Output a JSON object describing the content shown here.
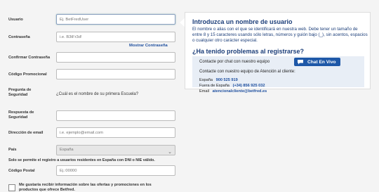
{
  "form": {
    "usuario": {
      "label": "Usuario",
      "placeholder": "Ej. BetFredUser"
    },
    "contrasena": {
      "label": "Contraseña",
      "placeholder": "i.e. B3tFr3d!"
    },
    "mostrar": "Mostrar Contraseña",
    "confirmar": {
      "label": "Confirmar Contraseña"
    },
    "promo": {
      "label": "Código Promocional"
    },
    "pregunta": {
      "label_line1": "Pregunta de",
      "label_line2": "Seguridad",
      "value": "¿Cuál es el nombre de su primera Escuela?"
    },
    "respuesta": {
      "label_line1": "Respuesta de",
      "label_line2": "Seguridad"
    },
    "email": {
      "label": "Dirección de email",
      "placeholder": "i.e. ejemplo@email.com"
    },
    "pais": {
      "label": "País",
      "value": "España"
    },
    "residentes_note": "Solo se permite el registro a usuarios residentes en España con DNI o NIE válido.",
    "postal": {
      "label": "Código Postal",
      "placeholder": "Ej.:00000"
    },
    "ofertas": "Me gustaría recibir información sobre las ofertas y promociones en los productos que ofrece Betfred."
  },
  "panel": {
    "title": "Introduzca un nombre de usuario",
    "text": "El nombre o alias con el que se identificará en nuestra web. Debe tener un tamaño de entre 8 y 15 caracteres usando sólo letras, números y guión bajo (_), sin acentos, espacios o cualquier otro carácter especial.",
    "problems_title": "¿Ha tenido problemas al registrarse?",
    "chat_text": "Contacte por chat con nuestro equipo",
    "chat_button": "Chat En Vivo",
    "atencion_text": "Contacte con nuestro equipo de Atención al cliente:",
    "espana_label": "España",
    "espana_phone": "900 525 919",
    "fuera_label": "Fuera de España",
    "fuera_phone": "(+34) 856 925 032",
    "email_label": "Email",
    "email_value": "atencionalcliente@betfred.es"
  },
  "colors": {
    "accent": "#1d3f7a",
    "button": "#1e58a8"
  }
}
